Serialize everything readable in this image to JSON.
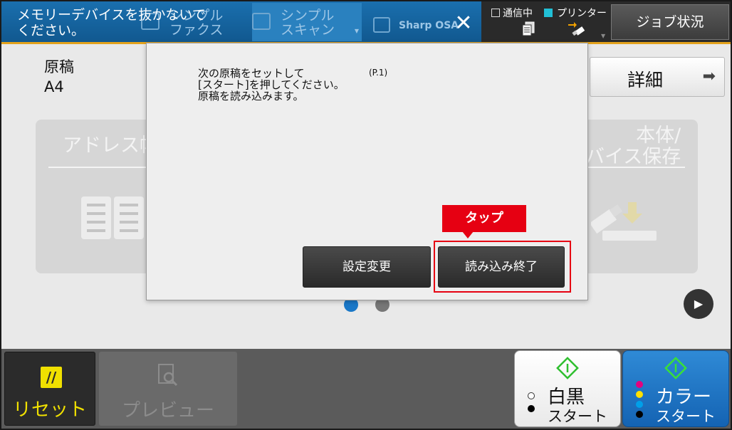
{
  "header": {
    "message": "メモリーデバイスを抜かないで\nください。",
    "tabs": [
      {
        "label": "シンプル\nファクス"
      },
      {
        "label": "シンプル\nスキャン"
      },
      {
        "label": "Sharp OSA"
      }
    ],
    "close_label": "✕",
    "status": {
      "comm_label": "通信中",
      "printer_label": "プリンター",
      "printer_color": "#21c0d6"
    },
    "job_status_label": "ジョブ状況",
    "accent_color": "#e3a21c"
  },
  "main": {
    "original_label": "原稿",
    "original_value": "A4",
    "detail_label": "詳細",
    "detail_arrow": "➡",
    "cards": [
      {
        "title": "アドレス帳"
      },
      {
        "title": "本体/\nバイス保存"
      }
    ],
    "next_label": "▶",
    "page_dots": [
      {
        "active": true
      },
      {
        "active": false
      }
    ]
  },
  "dialog": {
    "message": "次の原稿をセットして\n[スタート]を押してください。\n原稿を読み込みます。",
    "page_indicator": "(P.1)",
    "change_settings_label": "設定変更",
    "finish_reading_label": "読み込み終了",
    "tap_hint": "タップ",
    "highlight_color": "#e60012"
  },
  "bottom": {
    "reset_label": "リセット",
    "preview_label": "プレビュー",
    "bw_start": {
      "line1": "白黒",
      "line2": "スタート"
    },
    "color_start": {
      "line1": "カラー",
      "line2": "スタート"
    }
  }
}
